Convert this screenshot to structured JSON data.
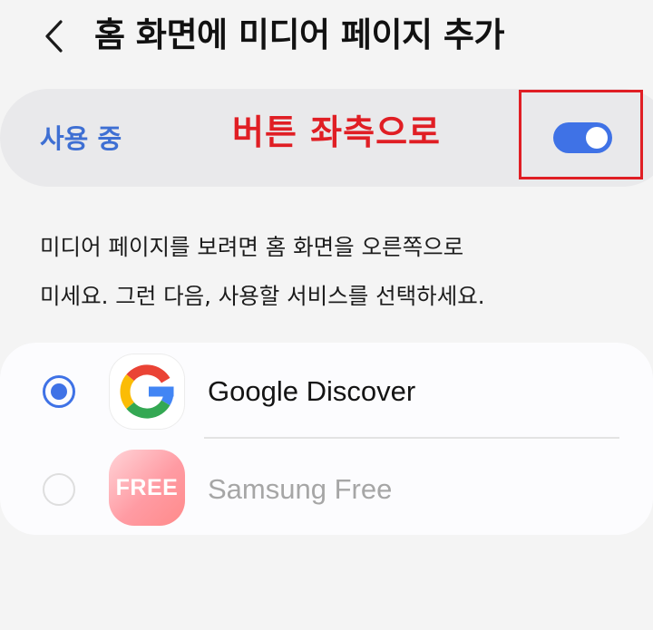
{
  "header": {
    "title": "홈 화면에 미디어 페이지 추가",
    "back_icon": "chevron-left-icon"
  },
  "master_switch": {
    "label": "사용 중",
    "state": "on",
    "accent_color": "#3f72e6"
  },
  "annotation": {
    "text": "버튼 좌측으로",
    "color": "#e01e24"
  },
  "description": {
    "line1": "미디어 페이지를 보려면 홈 화면을 오른쪽으로",
    "line2": "미세요. 그런 다음, 사용할 서비스를 선택하세요."
  },
  "options": [
    {
      "label": "Google Discover",
      "selected": true,
      "icon": "google-logo-icon"
    },
    {
      "label": "Samsung Free",
      "selected": false,
      "icon": "samsung-free-icon",
      "icon_text": "FREE"
    }
  ]
}
